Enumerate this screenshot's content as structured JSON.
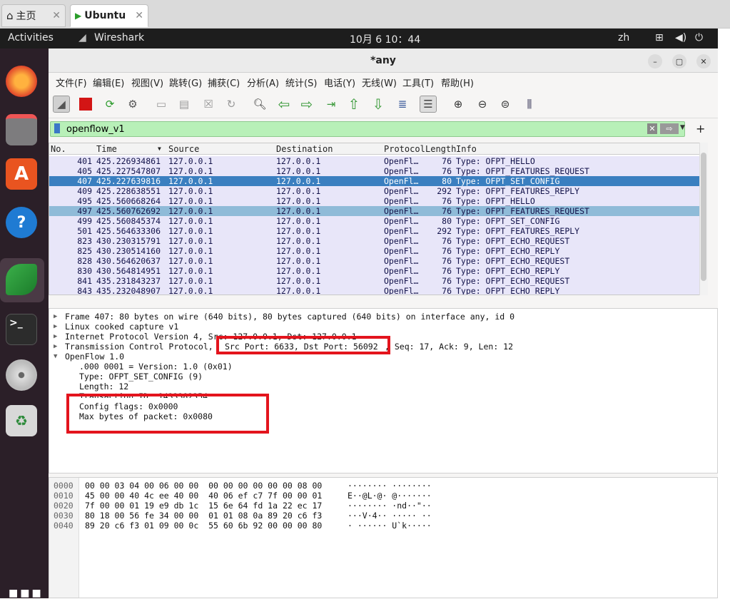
{
  "browser": {
    "tabs": [
      {
        "label": "主页",
        "active": false
      },
      {
        "label": "Ubuntu",
        "active": true
      }
    ]
  },
  "topbar": {
    "activities": "Activities",
    "app": "Wireshark",
    "clock": "10月 6 10：44",
    "lang": "zh"
  },
  "window": {
    "title": "*any"
  },
  "menu": [
    "文件(F)",
    "编辑(E)",
    "视图(V)",
    "跳转(G)",
    "捕获(C)",
    "分析(A)",
    "统计(S)",
    "电话(Y)",
    "无线(W)",
    "工具(T)",
    "帮助(H)"
  ],
  "filter": {
    "value": "openflow_v1"
  },
  "columns": [
    "No.",
    "Time",
    "Source",
    "Destination",
    "Protocol",
    "Length",
    "Info"
  ],
  "packets": [
    {
      "no": "401",
      "time": "425.226934861",
      "src": "127.0.0.1",
      "dst": "127.0.0.1",
      "proto": "OpenFl…",
      "len": "76",
      "info": "Type: OFPT_HELLO"
    },
    {
      "no": "405",
      "time": "425.227547807",
      "src": "127.0.0.1",
      "dst": "127.0.0.1",
      "proto": "OpenFl…",
      "len": "76",
      "info": "Type: OFPT_FEATURES_REQUEST"
    },
    {
      "no": "407",
      "time": "425.227639816",
      "src": "127.0.0.1",
      "dst": "127.0.0.1",
      "proto": "OpenFl…",
      "len": "80",
      "info": "Type: OFPT_SET_CONFIG"
    },
    {
      "no": "409",
      "time": "425.228638551",
      "src": "127.0.0.1",
      "dst": "127.0.0.1",
      "proto": "OpenFl…",
      "len": "292",
      "info": "Type: OFPT_FEATURES_REPLY"
    },
    {
      "no": "495",
      "time": "425.560668264",
      "src": "127.0.0.1",
      "dst": "127.0.0.1",
      "proto": "OpenFl…",
      "len": "76",
      "info": "Type: OFPT_HELLO"
    },
    {
      "no": "497",
      "time": "425.560762692",
      "src": "127.0.0.1",
      "dst": "127.0.0.1",
      "proto": "OpenFl…",
      "len": "76",
      "info": "Type: OFPT_FEATURES_REQUEST"
    },
    {
      "no": "499",
      "time": "425.560845374",
      "src": "127.0.0.1",
      "dst": "127.0.0.1",
      "proto": "OpenFl…",
      "len": "80",
      "info": "Type: OFPT_SET_CONFIG"
    },
    {
      "no": "501",
      "time": "425.564633306",
      "src": "127.0.0.1",
      "dst": "127.0.0.1",
      "proto": "OpenFl…",
      "len": "292",
      "info": "Type: OFPT_FEATURES_REPLY"
    },
    {
      "no": "823",
      "time": "430.230315791",
      "src": "127.0.0.1",
      "dst": "127.0.0.1",
      "proto": "OpenFl…",
      "len": "76",
      "info": "Type: OFPT_ECHO_REQUEST"
    },
    {
      "no": "825",
      "time": "430.230514160",
      "src": "127.0.0.1",
      "dst": "127.0.0.1",
      "proto": "OpenFl…",
      "len": "76",
      "info": "Type: OFPT_ECHO_REPLY"
    },
    {
      "no": "828",
      "time": "430.564620637",
      "src": "127.0.0.1",
      "dst": "127.0.0.1",
      "proto": "OpenFl…",
      "len": "76",
      "info": "Type: OFPT_ECHO_REQUEST"
    },
    {
      "no": "830",
      "time": "430.564814951",
      "src": "127.0.0.1",
      "dst": "127.0.0.1",
      "proto": "OpenFl…",
      "len": "76",
      "info": "Type: OFPT_ECHO_REPLY"
    },
    {
      "no": "841",
      "time": "435.231843237",
      "src": "127.0.0.1",
      "dst": "127.0.0.1",
      "proto": "OpenFl…",
      "len": "76",
      "info": "Type: OFPT_ECHO_REQUEST"
    },
    {
      "no": "843",
      "time": "435.232048907",
      "src": "127.0.0.1",
      "dst": "127.0.0.1",
      "proto": "OpenFl…",
      "len": "76",
      "info": "Type: OFPT_ECHO_REPLY"
    }
  ],
  "details": {
    "frame": "Frame 407: 80 bytes on wire (640 bits), 80 bytes captured (640 bits) on interface any, id 0",
    "linux": "Linux cooked capture v1",
    "ip": "Internet Protocol Version 4, Src: 127.0.0.1, Dst: 127.0.0.1",
    "tcp_prefix": "Transmission Control Protocol,",
    "tcp_ports": "Src Port: 6633, Dst Port: 56092",
    "tcp_suffix": ", Seq: 17, Ack: 9, Len: 12",
    "openflow": "OpenFlow 1.0",
    "version": ".000 0001 = Version: 1.0 (0x01)",
    "type": "Type: OFPT_SET_CONFIG (9)",
    "length": "Length: 12",
    "xid": "Transaction ID: 1433382354",
    "flags": "Config flags: 0x0000",
    "maxbytes": "Max bytes of packet: 0x0080"
  },
  "hex": [
    {
      "off": "0000",
      "bytes": "00 00 03 04 00 06 00 00  00 00 00 00 00 00 08 00",
      "ascii": "········ ········"
    },
    {
      "off": "0010",
      "bytes": "45 00 00 40 4c ee 40 00  40 06 ef c7 7f 00 00 01",
      "ascii": "E··@L·@· @·······"
    },
    {
      "off": "0020",
      "bytes": "7f 00 00 01 19 e9 db 1c  15 6e 64 fd 1a 22 ec 17",
      "ascii": "········ ·nd··\"··"
    },
    {
      "off": "0030",
      "bytes": "80 18 00 56 fe 34 00 00  01 01 08 0a 89 20 c6 f3",
      "ascii": "···V·4·· ····· ··"
    },
    {
      "off": "0040",
      "bytes": "89 20 c6 f3 01 09 00 0c  55 60 6b 92 00 00 00 80",
      "ascii": "· ······ U`k·····"
    }
  ]
}
